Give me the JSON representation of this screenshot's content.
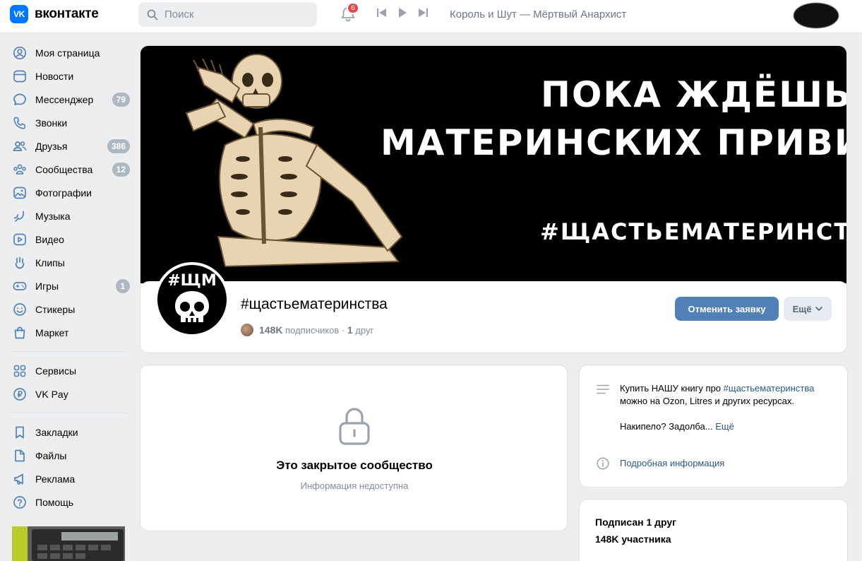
{
  "header": {
    "logo_text": "вконтакте",
    "logo_mark": "VK",
    "search_placeholder": "Поиск",
    "notifications_count": "6",
    "now_playing": "Король и Шут — Мёртвый Анархист"
  },
  "sidebar": {
    "items": [
      {
        "label": "Моя страница",
        "icon": "user-circle-icon",
        "count": ""
      },
      {
        "label": "Новости",
        "icon": "news-icon",
        "count": ""
      },
      {
        "label": "Мессенджер",
        "icon": "message-icon",
        "count": "79"
      },
      {
        "label": "Звонки",
        "icon": "phone-icon",
        "count": ""
      },
      {
        "label": "Друзья",
        "icon": "friends-icon",
        "count": "386"
      },
      {
        "label": "Сообщества",
        "icon": "communities-icon",
        "count": "12"
      },
      {
        "label": "Фотографии",
        "icon": "photo-icon",
        "count": ""
      },
      {
        "label": "Музыка",
        "icon": "music-icon",
        "count": ""
      },
      {
        "label": "Видео",
        "icon": "video-icon",
        "count": ""
      },
      {
        "label": "Клипы",
        "icon": "clips-icon",
        "count": ""
      },
      {
        "label": "Игры",
        "icon": "games-icon",
        "count": "1"
      },
      {
        "label": "Стикеры",
        "icon": "sticker-icon",
        "count": ""
      },
      {
        "label": "Маркет",
        "icon": "market-icon",
        "count": ""
      }
    ],
    "items2": [
      {
        "label": "Сервисы",
        "icon": "services-icon"
      },
      {
        "label": "VK Pay",
        "icon": "vkpay-icon"
      }
    ],
    "items3": [
      {
        "label": "Закладки",
        "icon": "bookmark-icon"
      },
      {
        "label": "Файлы",
        "icon": "file-icon"
      },
      {
        "label": "Реклама",
        "icon": "megaphone-icon"
      },
      {
        "label": "Помощь",
        "icon": "help-icon"
      }
    ]
  },
  "cover": {
    "line1": "ПОКА ЖДЁШЬ",
    "line2": "МАТЕРИНСКИХ ПРИВИ",
    "line3": "#ЩАСТЬЕМАТЕРИНСТВА"
  },
  "group": {
    "avatar_tag": "#ЩМ",
    "name": "#щастьематеринства",
    "subscribers": "148K",
    "subscribers_label": "подписчиков",
    "dot": "·",
    "friends": "1",
    "friends_label": "друг",
    "cancel_button": "Отменить заявку",
    "more_button": "Ещё"
  },
  "closed": {
    "title": "Это закрытое сообщество",
    "subtitle": "Информация недоступна"
  },
  "info": {
    "desc_pre": "Купить НАШУ книгу про ",
    "desc_link": "#щастьематеринства",
    "desc_post": " можно на Ozon, Litres и других ресурсах.",
    "desc_p2": "Накипело? Задолба...",
    "desc_more": "Ещё",
    "detail_link": "Подробная информация"
  },
  "friends_card": {
    "title": "Подписан 1 друг",
    "members": "148K участника"
  }
}
